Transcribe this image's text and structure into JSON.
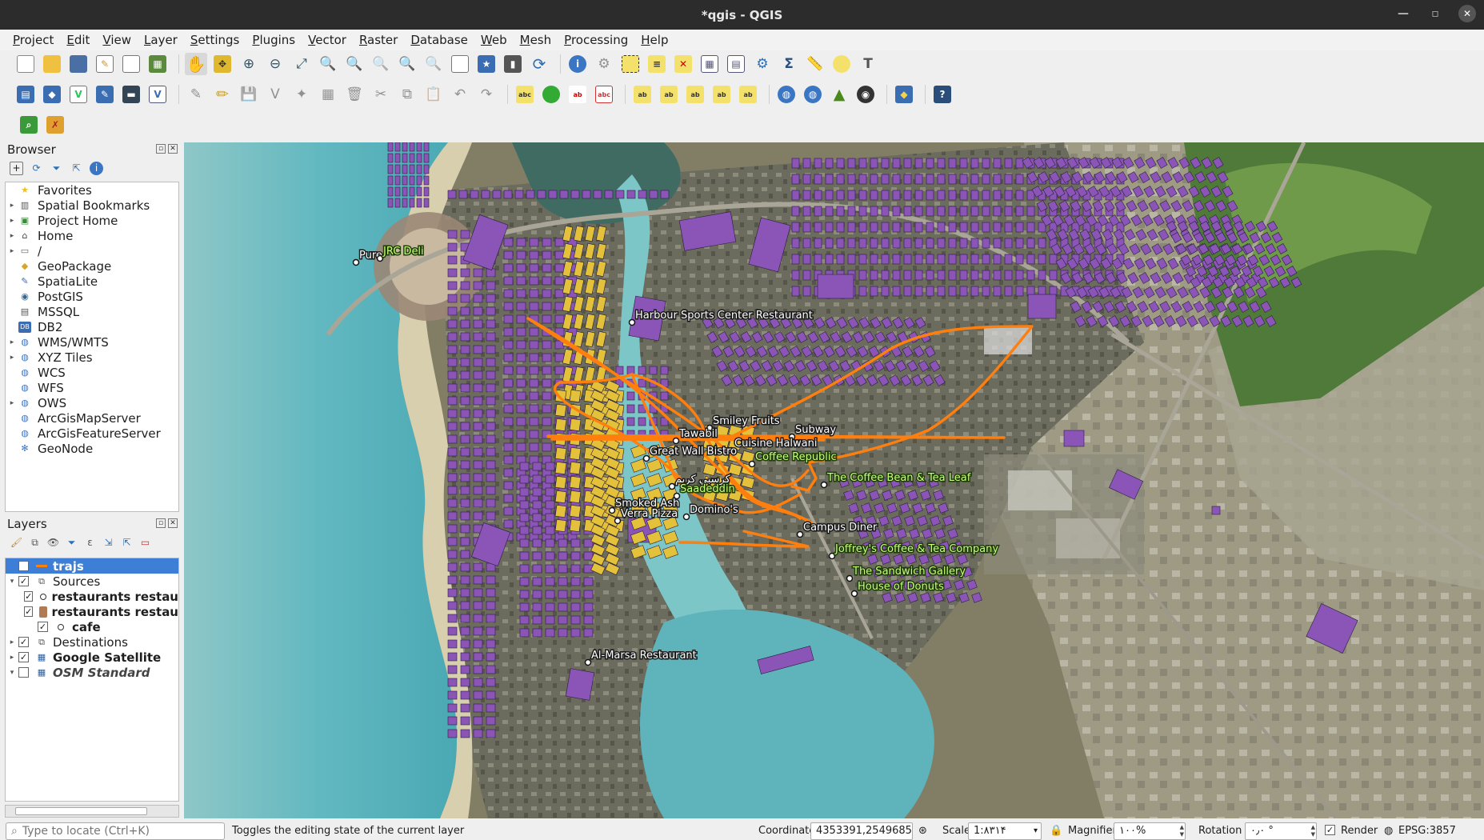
{
  "window": {
    "title": "*qgis - QGIS"
  },
  "menubar": {
    "items": [
      "Project",
      "Edit",
      "View",
      "Layer",
      "Settings",
      "Plugins",
      "Vector",
      "Raster",
      "Database",
      "Web",
      "Mesh",
      "Processing",
      "Help"
    ]
  },
  "browser": {
    "title": "Browser",
    "items": [
      {
        "label": "Favorites",
        "icon": "star-icon",
        "expandable": false
      },
      {
        "label": "Spatial Bookmarks",
        "icon": "bookmark-icon",
        "expandable": true
      },
      {
        "label": "Project Home",
        "icon": "project-home-icon",
        "expandable": true
      },
      {
        "label": "Home",
        "icon": "home-folder-icon",
        "expandable": true
      },
      {
        "label": "/",
        "icon": "folder-icon",
        "expandable": true
      },
      {
        "label": "GeoPackage",
        "icon": "geopackage-icon",
        "expandable": false
      },
      {
        "label": "SpatiaLite",
        "icon": "spatialite-icon",
        "expandable": false
      },
      {
        "label": "PostGIS",
        "icon": "postgis-icon",
        "expandable": false
      },
      {
        "label": "MSSQL",
        "icon": "mssql-icon",
        "expandable": false
      },
      {
        "label": "DB2",
        "icon": "db2-icon",
        "expandable": false
      },
      {
        "label": "WMS/WMTS",
        "icon": "wms-icon",
        "expandable": true
      },
      {
        "label": "XYZ Tiles",
        "icon": "xyz-icon",
        "expandable": true
      },
      {
        "label": "WCS",
        "icon": "wcs-icon",
        "expandable": false
      },
      {
        "label": "WFS",
        "icon": "wfs-icon",
        "expandable": false
      },
      {
        "label": "OWS",
        "icon": "ows-icon",
        "expandable": true
      },
      {
        "label": "ArcGisMapServer",
        "icon": "arcgis-icon",
        "expandable": false
      },
      {
        "label": "ArcGisFeatureServer",
        "icon": "arcgis-feature-icon",
        "expandable": false
      },
      {
        "label": "GeoNode",
        "icon": "geonode-icon",
        "expandable": false
      }
    ]
  },
  "layers": {
    "title": "Layers",
    "items": [
      {
        "label": "trajs",
        "checked": true,
        "selected": true,
        "indent": 0,
        "expand": "",
        "style": "bold",
        "icon": "line-layer-icon"
      },
      {
        "label": "Sources",
        "checked": true,
        "indent": 0,
        "expand": "▾",
        "style": "",
        "icon": "group-icon"
      },
      {
        "label": "restaurants restau",
        "checked": true,
        "indent": 1,
        "expand": "",
        "style": "bold",
        "icon": "point-layer-icon"
      },
      {
        "label": "restaurants restau",
        "checked": true,
        "indent": 1,
        "expand": "",
        "style": "bold",
        "icon": "polygon-layer-icon"
      },
      {
        "label": "cafe",
        "checked": true,
        "indent": 1,
        "expand": "",
        "style": "bold",
        "icon": "point-layer-icon"
      },
      {
        "label": "Destinations",
        "checked": true,
        "indent": 0,
        "expand": "▸",
        "style": "",
        "icon": "group-icon"
      },
      {
        "label": "Google Satellite",
        "checked": true,
        "indent": 0,
        "expand": "▸",
        "style": "bold",
        "icon": "raster-layer-icon"
      },
      {
        "label": "OSM Standard",
        "checked": false,
        "indent": 0,
        "expand": "▾",
        "style": "italic",
        "icon": "raster-layer-icon"
      }
    ]
  },
  "map": {
    "labels_white": [
      "Pure",
      "Harbour Sports Center Restaurant",
      "Smiley Fruits",
      "Tawabil",
      "Subway",
      "Cuisine Halwani",
      "Great Wall Bistro",
      "كرسبي كريم",
      "Smoked Ash",
      "Verra Pizza",
      "Domino's",
      "Campus Diner",
      "Al-Marsa Restaurant"
    ],
    "labels_green": [
      "JRC Deli",
      "Coffee Republic",
      "The Coffee Bean & Tea Leaf",
      "Saadeddin",
      "Joffrey's Coffee & Tea Company",
      "The Sandwich Gallery",
      "House of Donuts"
    ],
    "colors": {
      "route": "#ff7f0e",
      "building": "#8b55b8",
      "restaurant": "#e3c13a",
      "sea": "#6fc3c9"
    }
  },
  "status": {
    "locator_placeholder": "Type to locate (Ctrl+K)",
    "message": "Toggles the editing state of the current layer",
    "coordinate_label": "Coordinate",
    "coordinate": "4353391,2549685",
    "scale_label": "Scale",
    "scale": "1:۸۳۱۴",
    "magnifier_label": "Magnifier",
    "magnifier": "۱۰۰%",
    "rotation_label": "Rotation",
    "rotation": "۰٫۰ °",
    "render_label": "Render",
    "crs": "EPSG:3857"
  }
}
